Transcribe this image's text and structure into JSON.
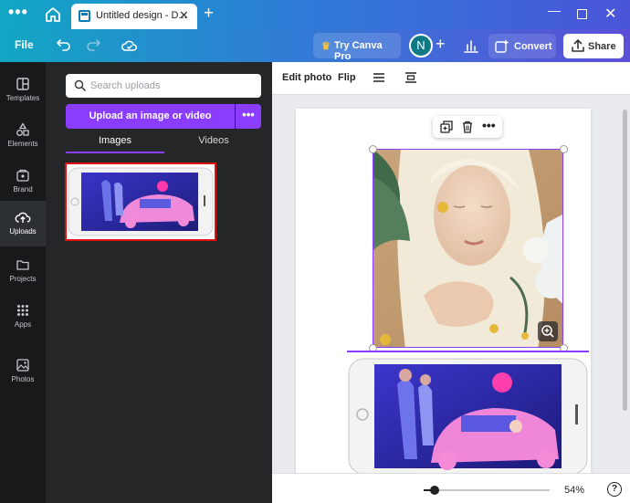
{
  "window": {
    "tab_title": "Untitled design - D...",
    "new_tab": "+"
  },
  "header": {
    "file_label": "File",
    "pro_label": "Try Canva Pro",
    "avatar_initial": "N",
    "convert_label": "Convert",
    "share_label": "Share"
  },
  "rail": {
    "items": [
      {
        "label": "Templates"
      },
      {
        "label": "Elements"
      },
      {
        "label": "Brand"
      },
      {
        "label": "Uploads"
      },
      {
        "label": "Projects"
      },
      {
        "label": "Apps"
      },
      {
        "label": "Photos"
      }
    ]
  },
  "uploads": {
    "search_placeholder": "Search uploads",
    "upload_label": "Upload an image or video",
    "more_label": "•••",
    "tabs": [
      {
        "label": "Images",
        "active": true
      },
      {
        "label": "Videos",
        "active": false
      }
    ]
  },
  "toolbar": {
    "edit_photo": "Edit photo",
    "flip": "Flip"
  },
  "footer": {
    "zoom_percent": 54,
    "zoom_label": "54%",
    "help": "?"
  },
  "colors": {
    "accent": "#8b3dff",
    "selection_outline": "#e01010"
  }
}
